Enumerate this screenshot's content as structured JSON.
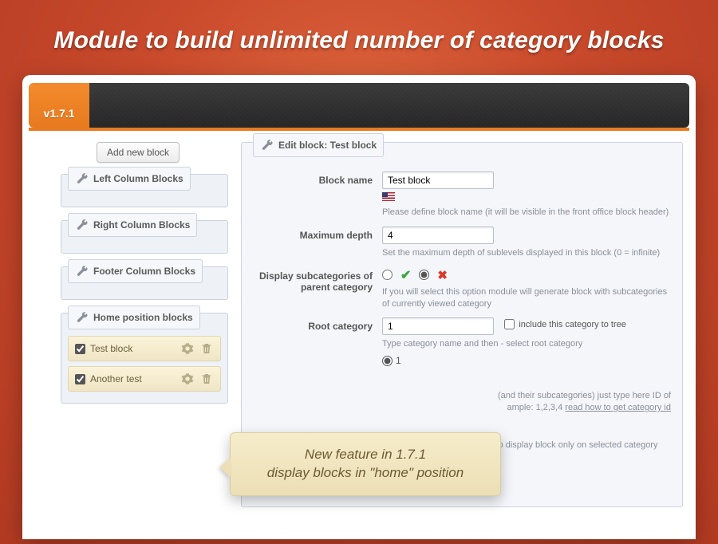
{
  "hero": "Module to build unlimited number of category blocks",
  "version": "v1.7.1",
  "add_button": "Add new block",
  "panels": {
    "left": "Left Column Blocks",
    "right": "Right Column Blocks",
    "footer": "Footer Column Blocks",
    "home": "Home position blocks"
  },
  "home_blocks": [
    {
      "name": "Test block",
      "checked": true
    },
    {
      "name": "Another test",
      "checked": true
    }
  ],
  "form": {
    "legend": "Edit block: Test block",
    "block_name": {
      "label": "Block name",
      "value": "Test block",
      "hint": "Please define block name (it will be visible in the front office block header)"
    },
    "max_depth": {
      "label": "Maximum depth",
      "value": "4",
      "hint": "Set the maximum depth of sublevels displayed in this block (0 = infinite)"
    },
    "display_sub": {
      "label": "Display subcategories of parent category",
      "hint": "If you will select this option module will generate block with subcategories of currently viewed category"
    },
    "root": {
      "label": "Root category",
      "value": "1",
      "include_label": "include this category to tree",
      "hint": "Type category name and then - select root category",
      "tree_value": "1"
    },
    "exclude": {
      "hint_part1": "(and their subcategories) just type here ID of",
      "hint_part2_prefix": "ample: 1,2,3,4 ",
      "hint_part2_link": "read how to get category id"
    },
    "bottom_hint": "Select this option if you want to display block only on selected category pages"
  },
  "callout": {
    "line1": "New feature in 1.7.1",
    "line2": "display blocks in \"home\" position"
  }
}
